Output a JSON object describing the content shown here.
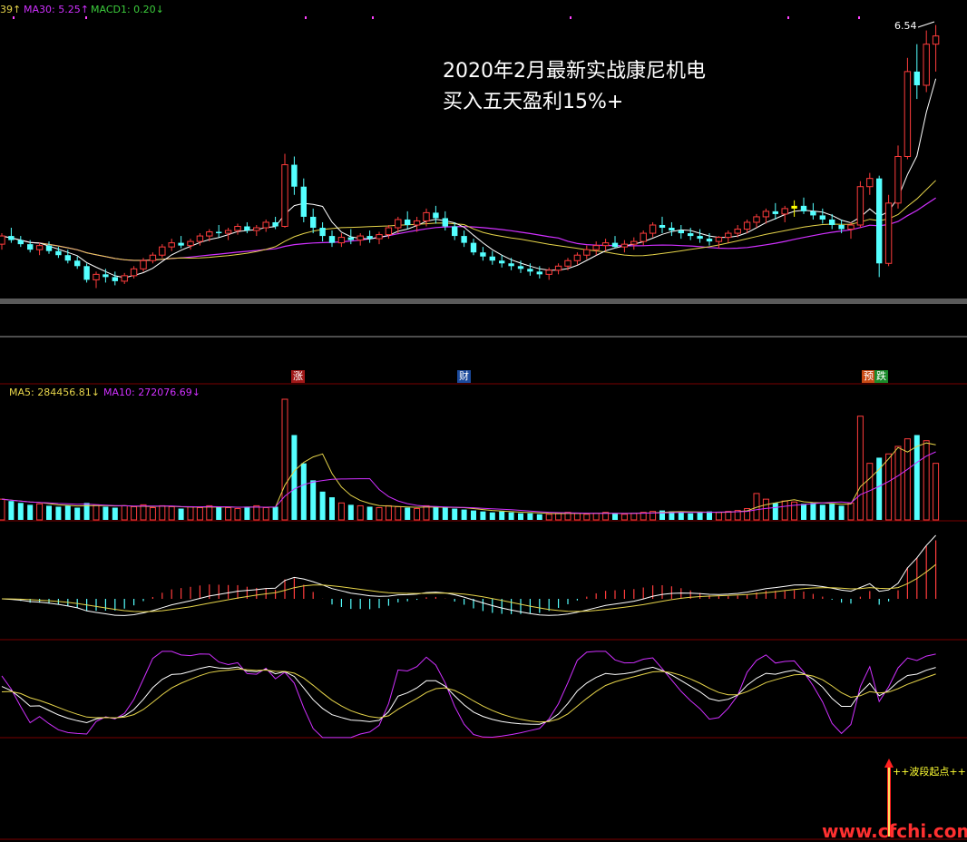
{
  "colors": {
    "bg": "#000000",
    "up": "#ff3c3c",
    "down": "#54ffff",
    "ma_white": "#ffffff",
    "ma_yellow": "#e6d44a",
    "ma_purple": "#d030ff",
    "grid": "#7a0000",
    "divider": "#888888",
    "highlight": "#ffff00"
  },
  "legend": {
    "prefix": "39↑",
    "ma30": "MA30: 5.25↑",
    "macd1": "MACD1: 0.20↓"
  },
  "vol_legend": {
    "ma5": "MA5: 284456.81↓",
    "ma10": "MA10: 272076.69↓"
  },
  "annotation": {
    "line1": "2020年2月最新实战康尼机电",
    "line2": "买入五天盈利15%+"
  },
  "price_high_label": "6.54",
  "markers": {
    "zhang": "涨",
    "cai": "财",
    "yu": "预",
    "die": "跌"
  },
  "signal_label": "++波段起点++",
  "watermark": "www.cfchi.com",
  "chart_data": [
    {
      "type": "candlestick",
      "panel": "price",
      "candles": [
        [
          4.94,
          5.02,
          4.9,
          5.0
        ],
        [
          5.0,
          5.06,
          4.95,
          4.97
        ],
        [
          4.97,
          5.0,
          4.92,
          4.94
        ],
        [
          4.94,
          4.97,
          4.88,
          4.9
        ],
        [
          4.9,
          4.95,
          4.86,
          4.93
        ],
        [
          4.93,
          4.96,
          4.87,
          4.89
        ],
        [
          4.89,
          4.92,
          4.84,
          4.86
        ],
        [
          4.86,
          4.9,
          4.8,
          4.82
        ],
        [
          4.82,
          4.85,
          4.76,
          4.78
        ],
        [
          4.78,
          4.8,
          4.66,
          4.68
        ],
        [
          4.68,
          4.74,
          4.62,
          4.72
        ],
        [
          4.72,
          4.76,
          4.66,
          4.7
        ],
        [
          4.7,
          4.74,
          4.64,
          4.67
        ],
        [
          4.67,
          4.73,
          4.65,
          4.71
        ],
        [
          4.71,
          4.78,
          4.69,
          4.76
        ],
        [
          4.76,
          4.84,
          4.74,
          4.82
        ],
        [
          4.82,
          4.88,
          4.8,
          4.86
        ],
        [
          4.86,
          4.94,
          4.84,
          4.92
        ],
        [
          4.92,
          4.98,
          4.89,
          4.95
        ],
        [
          4.95,
          5.0,
          4.91,
          4.93
        ],
        [
          4.93,
          4.98,
          4.9,
          4.96
        ],
        [
          4.96,
          5.02,
          4.93,
          5.0
        ],
        [
          5.0,
          5.05,
          4.96,
          5.03
        ],
        [
          5.03,
          5.08,
          4.99,
          5.02
        ],
        [
          5.02,
          5.06,
          4.97,
          5.04
        ],
        [
          5.04,
          5.09,
          5.01,
          5.07
        ],
        [
          5.07,
          5.1,
          5.02,
          5.04
        ],
        [
          5.04,
          5.08,
          5.0,
          5.06
        ],
        [
          5.06,
          5.12,
          5.03,
          5.1
        ],
        [
          5.1,
          5.14,
          5.05,
          5.07
        ],
        [
          5.07,
          5.6,
          5.06,
          5.52
        ],
        [
          5.52,
          5.58,
          5.3,
          5.36
        ],
        [
          5.36,
          5.42,
          5.1,
          5.14
        ],
        [
          5.14,
          5.2,
          5.02,
          5.06
        ],
        [
          5.06,
          5.1,
          4.96,
          5.0
        ],
        [
          5.0,
          5.04,
          4.92,
          4.95
        ],
        [
          4.95,
          5.02,
          4.92,
          4.99
        ],
        [
          4.99,
          5.05,
          4.94,
          4.97
        ],
        [
          4.97,
          5.02,
          4.93,
          5.0
        ],
        [
          5.0,
          5.04,
          4.95,
          4.98
        ],
        [
          4.98,
          5.03,
          4.94,
          5.01
        ],
        [
          5.01,
          5.08,
          4.98,
          5.06
        ],
        [
          5.06,
          5.14,
          5.02,
          5.12
        ],
        [
          5.12,
          5.18,
          5.05,
          5.08
        ],
        [
          5.08,
          5.14,
          5.03,
          5.11
        ],
        [
          5.11,
          5.2,
          5.07,
          5.17
        ],
        [
          5.17,
          5.22,
          5.09,
          5.13
        ],
        [
          5.13,
          5.18,
          5.04,
          5.07
        ],
        [
          5.07,
          5.1,
          4.97,
          5.0
        ],
        [
          5.0,
          5.04,
          4.92,
          4.95
        ],
        [
          4.95,
          4.98,
          4.86,
          4.88
        ],
        [
          4.88,
          4.92,
          4.82,
          4.85
        ],
        [
          4.85,
          4.89,
          4.79,
          4.82
        ],
        [
          4.82,
          4.86,
          4.77,
          4.8
        ],
        [
          4.8,
          4.84,
          4.75,
          4.78
        ],
        [
          4.78,
          4.82,
          4.73,
          4.76
        ],
        [
          4.76,
          4.8,
          4.71,
          4.74
        ],
        [
          4.74,
          4.78,
          4.69,
          4.72
        ],
        [
          4.72,
          4.77,
          4.68,
          4.75
        ],
        [
          4.75,
          4.8,
          4.72,
          4.78
        ],
        [
          4.78,
          4.84,
          4.75,
          4.82
        ],
        [
          4.82,
          4.88,
          4.79,
          4.86
        ],
        [
          4.86,
          4.93,
          4.83,
          4.9
        ],
        [
          4.9,
          4.96,
          4.86,
          4.93
        ],
        [
          4.93,
          4.98,
          4.89,
          4.95
        ],
        [
          4.95,
          5.0,
          4.91,
          4.92
        ],
        [
          4.92,
          4.97,
          4.88,
          4.94
        ],
        [
          4.94,
          4.99,
          4.9,
          4.96
        ],
        [
          4.96,
          5.04,
          4.93,
          5.02
        ],
        [
          5.02,
          5.1,
          4.99,
          5.08
        ],
        [
          5.08,
          5.14,
          5.02,
          5.06
        ],
        [
          5.06,
          5.1,
          5.0,
          5.04
        ],
        [
          5.04,
          5.08,
          4.98,
          5.02
        ],
        [
          5.02,
          5.06,
          4.97,
          5.0
        ],
        [
          5.0,
          5.05,
          4.95,
          4.98
        ],
        [
          4.98,
          5.02,
          4.93,
          4.96
        ],
        [
          4.96,
          5.0,
          4.91,
          4.99
        ],
        [
          4.99,
          5.04,
          4.95,
          5.02
        ],
        [
          5.02,
          5.08,
          4.99,
          5.05
        ],
        [
          5.05,
          5.12,
          5.02,
          5.1
        ],
        [
          5.1,
          5.16,
          5.06,
          5.14
        ],
        [
          5.14,
          5.2,
          5.09,
          5.18
        ],
        [
          5.18,
          5.24,
          5.12,
          5.16
        ],
        [
          5.16,
          5.22,
          5.1,
          5.2
        ],
        [
          5.2,
          5.26,
          5.14,
          5.22
        ],
        [
          5.22,
          5.28,
          5.16,
          5.18
        ],
        [
          5.18,
          5.24,
          5.12,
          5.15
        ],
        [
          5.15,
          5.2,
          5.09,
          5.12
        ],
        [
          5.12,
          5.16,
          5.05,
          5.08
        ],
        [
          5.08,
          5.12,
          5.02,
          5.05
        ],
        [
          5.05,
          5.1,
          4.98,
          5.08
        ],
        [
          5.08,
          5.4,
          5.06,
          5.36
        ],
        [
          5.36,
          5.46,
          5.3,
          5.42
        ],
        [
          5.42,
          5.44,
          4.7,
          4.8
        ],
        [
          4.8,
          5.3,
          4.78,
          5.24
        ],
        [
          5.24,
          5.66,
          5.2,
          5.58
        ],
        [
          5.58,
          6.3,
          5.56,
          6.2
        ],
        [
          6.2,
          6.4,
          6.0,
          6.1
        ],
        [
          6.1,
          6.5,
          6.05,
          6.4
        ],
        [
          6.4,
          6.54,
          6.2,
          6.46
        ]
      ],
      "ma_series": [
        {
          "name": "",
          "type": "white"
        },
        {
          "name": "",
          "type": "yellow"
        },
        {
          "name": "MA30",
          "type": "purple"
        }
      ],
      "highlight_index": 84,
      "max_label": 6.54
    },
    {
      "type": "bar",
      "panel": "volume",
      "series": [
        {
          "name": "MA5",
          "last": 284456.81
        },
        {
          "name": "MA10",
          "last": 272076.69
        }
      ],
      "values": [
        22,
        20,
        18,
        16,
        17,
        15,
        14,
        15,
        13,
        18,
        16,
        14,
        13,
        15,
        14,
        16,
        13,
        15,
        14,
        12,
        14,
        13,
        15,
        14,
        13,
        12,
        14,
        15,
        13,
        14,
        128,
        90,
        60,
        42,
        30,
        24,
        18,
        16,
        15,
        14,
        13,
        15,
        14,
        13,
        12,
        15,
        14,
        13,
        12,
        11,
        10,
        9,
        8,
        9,
        8,
        7,
        7,
        6,
        6,
        7,
        8,
        7,
        6,
        7,
        8,
        7,
        6,
        7,
        8,
        9,
        10,
        9,
        8,
        7,
        8,
        9,
        8,
        9,
        10,
        12,
        28,
        22,
        18,
        20,
        19,
        17,
        18,
        16,
        17,
        15,
        18,
        110,
        60,
        66,
        70,
        78,
        86,
        90,
        84,
        60
      ]
    },
    {
      "type": "line",
      "panel": "macd",
      "series": [
        {
          "name": "MACD1",
          "last": 0.2
        }
      ]
    },
    {
      "type": "line",
      "panel": "kdj",
      "series": [
        {
          "name": "",
          "type": "white"
        },
        {
          "name": "",
          "type": "yellow"
        },
        {
          "name": "",
          "type": "purple"
        }
      ]
    }
  ]
}
